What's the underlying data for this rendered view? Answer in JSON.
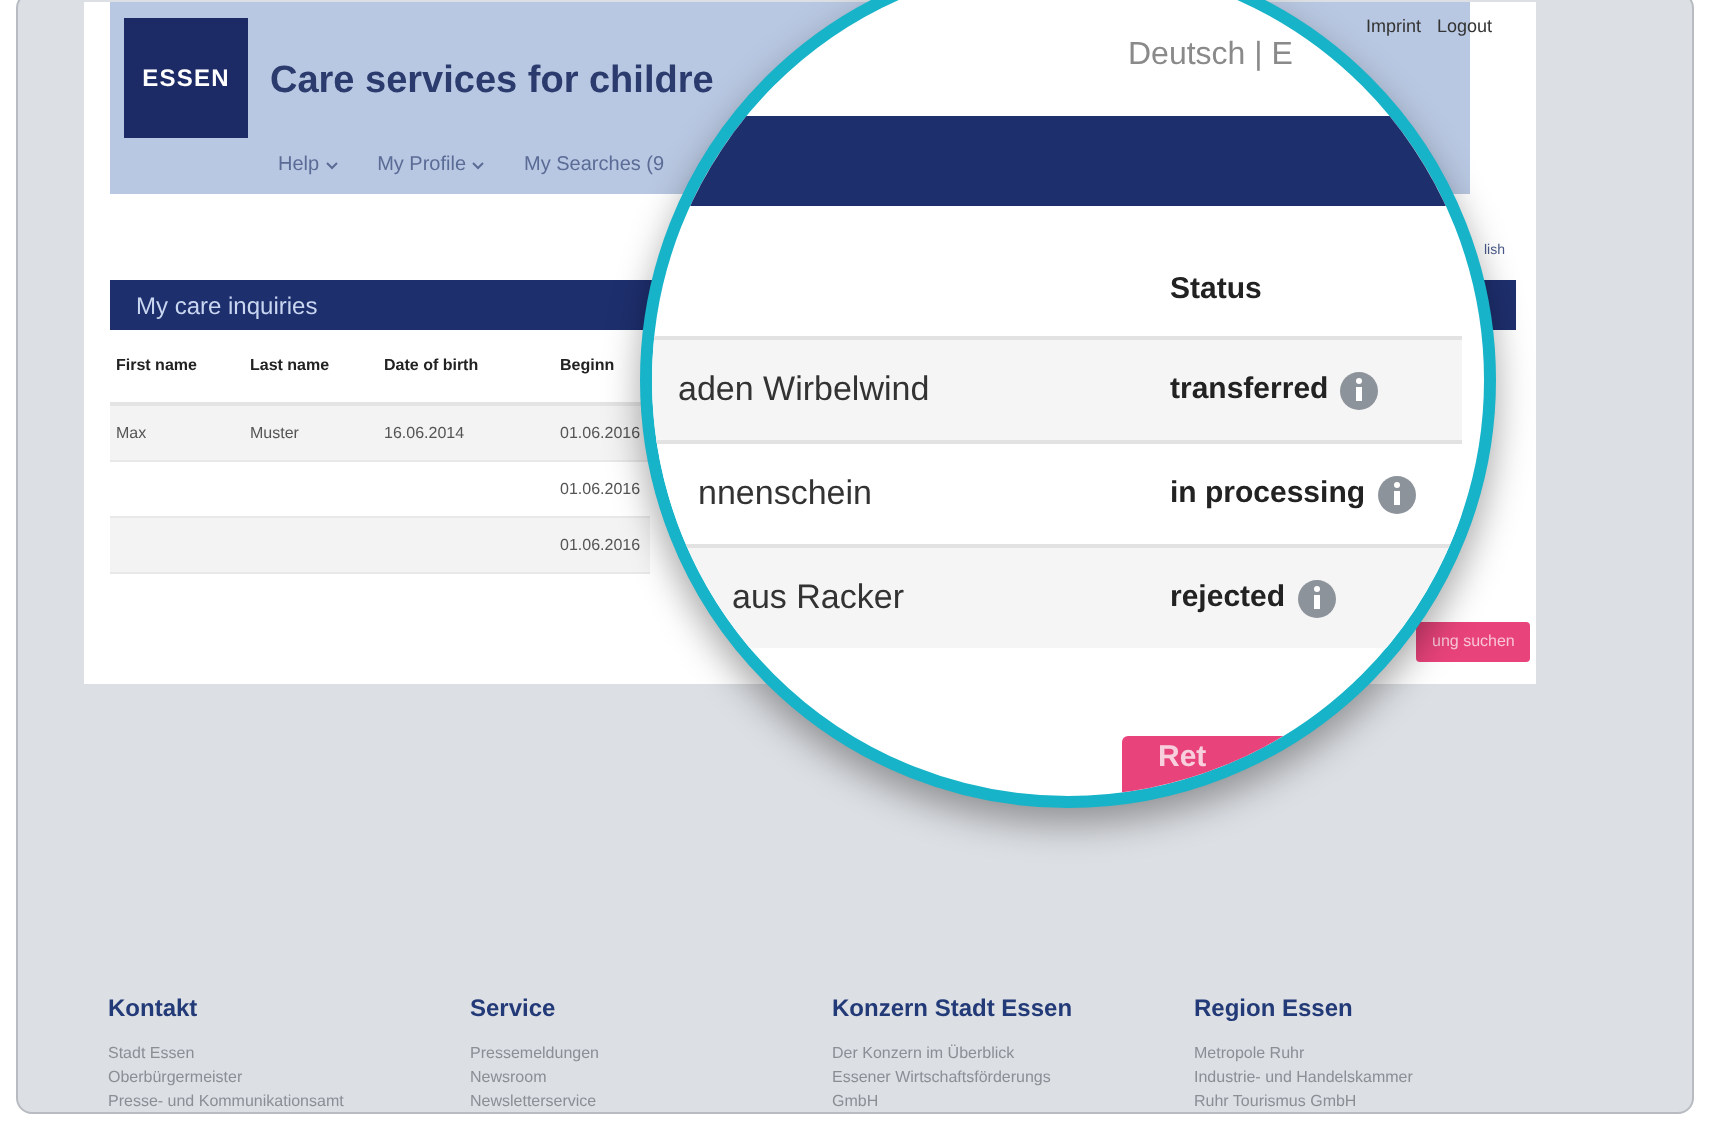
{
  "header": {
    "logo": "ESSEN",
    "title": "Care services for childre",
    "nav": [
      {
        "label": "Help",
        "dropdown": true
      },
      {
        "label": "My Profile",
        "dropdown": true
      },
      {
        "label": "My Searches (9",
        "dropdown": false
      }
    ],
    "top_links": [
      "Imprint",
      "Logout"
    ],
    "language": "Deutsch | E",
    "language_link": "lish"
  },
  "inquiries": {
    "title": "My care inquiries",
    "columns": [
      "First name",
      "Last name",
      "Date of birth",
      "Beginn"
    ],
    "rows": [
      {
        "first_name": "Max",
        "last_name": "Muster",
        "date_of_birth": "16.06.2014",
        "begin": "01.06.2016"
      },
      {
        "begin": "01.06.2016"
      },
      {
        "begin": "01.06.2016"
      }
    ],
    "search_button": "ung suchen"
  },
  "magnifier": {
    "column": "Status",
    "rows": [
      {
        "name": "aden Wirbelwind",
        "status": "transferred"
      },
      {
        "name": "nnenschein",
        "status": "in processing"
      },
      {
        "name": "aus Racker",
        "status": "rejected"
      }
    ],
    "button": "Ret"
  },
  "footer": {
    "columns": [
      {
        "heading": "Kontakt",
        "links": [
          "Stadt Essen",
          "Oberbürgermeister",
          "Presse- und Kommunikationsamt"
        ]
      },
      {
        "heading": "Service",
        "links": [
          "Pressemeldungen",
          "Newsroom",
          "Newsletterservice"
        ]
      },
      {
        "heading": "Konzern Stadt Essen",
        "links": [
          "Der Konzern im Überblick",
          "Essener Wirtschaftsförderungs",
          "GmbH"
        ]
      },
      {
        "heading": "Region Essen",
        "links": [
          "Metropole Ruhr",
          "Industrie- und Handelskammer",
          "Ruhr Tourismus GmbH"
        ]
      }
    ]
  }
}
